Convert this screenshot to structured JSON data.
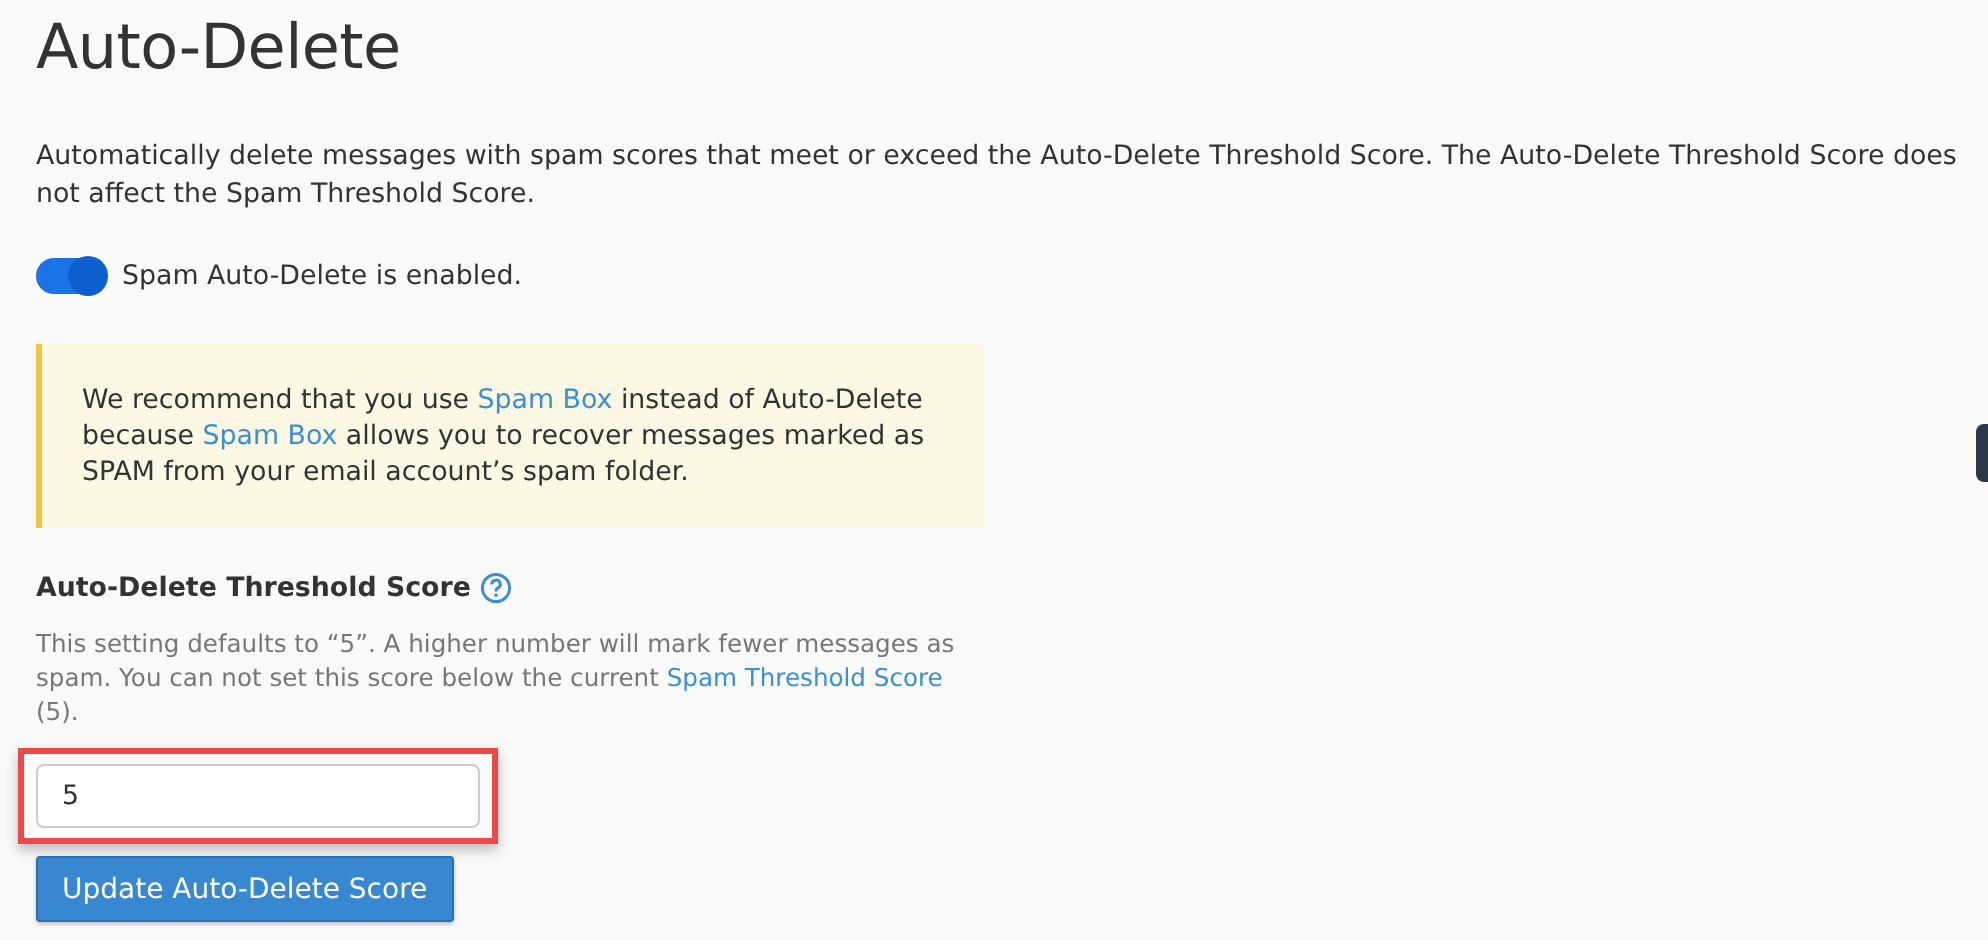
{
  "title": "Auto-Delete",
  "description": "Automatically delete messages with spam scores that meet or exceed the Auto-Delete Threshold Score. The Auto-Delete Threshold Score does not affect the Spam Threshold Score.",
  "toggle": {
    "label": "Spam Auto-Delete is enabled.",
    "on": true
  },
  "notice": {
    "parts": [
      {
        "kind": "text",
        "text": "We recommend that you use "
      },
      {
        "kind": "link",
        "text": "Spam Box"
      },
      {
        "kind": "text",
        "text": " instead of Auto-Delete because "
      },
      {
        "kind": "link",
        "text": "Spam Box"
      },
      {
        "kind": "text",
        "text": " allows you to recover messages marked as SPAM from your email account’s spam folder."
      }
    ]
  },
  "threshold": {
    "label": "Auto-Delete Threshold Score",
    "help": [
      {
        "kind": "text",
        "text": "This setting defaults to “5”. A higher number will mark fewer messages as spam. You can not set this score below the current "
      },
      {
        "kind": "link",
        "text": "Spam Threshold Score"
      },
      {
        "kind": "text",
        "text": " (5)."
      }
    ],
    "value": "5",
    "highlighted": true
  },
  "button": "Update Auto-Delete Score"
}
